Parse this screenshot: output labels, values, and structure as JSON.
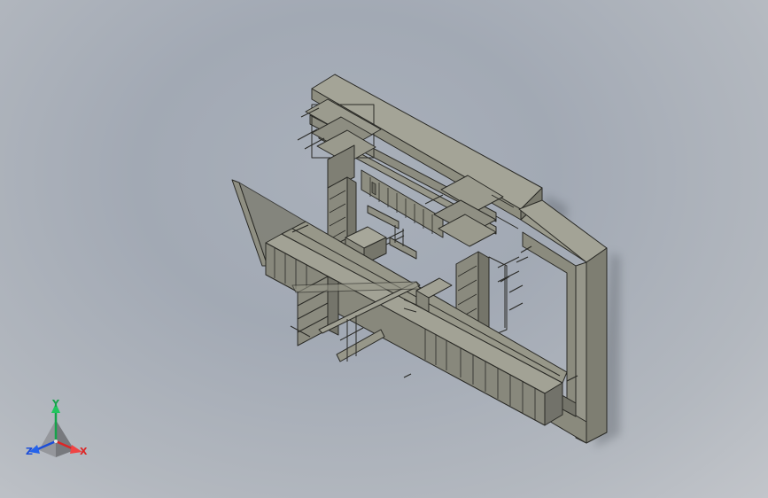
{
  "viewport": {
    "background_top": "#a2a9b4",
    "background_bottom": "#c2c5ca",
    "model_color": "#8c8c80",
    "model_edge_color": "#2a2a26"
  },
  "triad": {
    "x_label": "X",
    "y_label": "Y",
    "z_label": "Z",
    "x_color": "#dc2626",
    "y_color": "#16a34a",
    "z_color": "#1d4ed8"
  }
}
